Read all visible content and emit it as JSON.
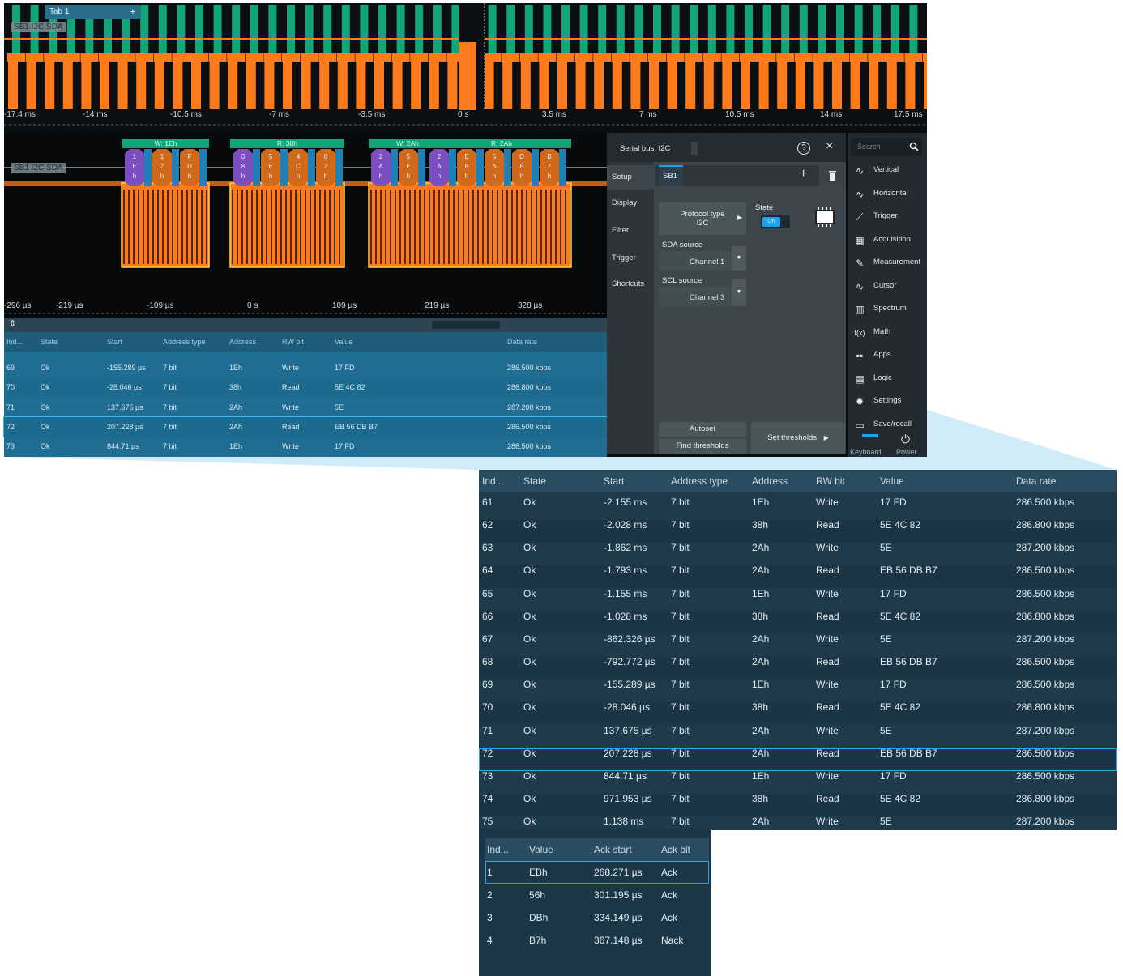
{
  "tab": {
    "label": "Tab 1",
    "plus": "+"
  },
  "overview": {
    "label": "SB1 I2C SDA",
    "ticks": [
      "-17.4 ms",
      "-14 ms",
      "-10.5 ms",
      "-7 ms",
      "-3.5 ms",
      "0 s",
      "3.5 ms",
      "7 ms",
      "10.5 ms",
      "14 ms",
      "17.5 ms"
    ]
  },
  "zoom": {
    "label": "SB1 I2C SDA",
    "frames": [
      "W: 1Eh",
      "R: 38h",
      "W: 2Ah",
      "R: 2Ah"
    ],
    "bytes": [
      [
        "1",
        "E",
        "h"
      ],
      [
        "1",
        "7",
        "h"
      ],
      [
        "F",
        "D",
        "h"
      ],
      [
        "3",
        "8",
        "h"
      ],
      [
        "5",
        "E",
        "h"
      ],
      [
        "4",
        "C",
        "h"
      ],
      [
        "8",
        "2",
        "h"
      ],
      [
        "2",
        "A",
        "h"
      ],
      [
        "5",
        "E",
        "h"
      ],
      [
        "2",
        "A",
        "h"
      ],
      [
        "E",
        "B",
        "h"
      ],
      [
        "5",
        "6",
        "h"
      ],
      [
        "D",
        "B",
        "h"
      ],
      [
        "B",
        "7",
        "h"
      ]
    ],
    "ticks": [
      "-296 µs",
      "-219 µs",
      "-109 µs",
      "0 s",
      "109 µs",
      "219 µs",
      "328 µs"
    ]
  },
  "panel": {
    "title": "Serial bus: I2C",
    "help": "?",
    "close": "×",
    "nav": [
      "Setup",
      "Display",
      "Filter",
      "Trigger",
      "Shortcuts"
    ],
    "sb_tab": "SB1",
    "add": "+",
    "delete_glyph": "🗑",
    "protocol_label": "Protocol type",
    "protocol_value": "I2C",
    "state_label": "State",
    "state_value": "On",
    "sda_label": "SDA source",
    "sda_value": "Channel 1",
    "scl_label": "SCL source",
    "scl_value": "Channel 3",
    "autoset": "Autoset",
    "find_thresholds": "Find thresholds",
    "set_thresholds": "Set thresholds"
  },
  "menu": {
    "search_placeholder": "Search",
    "items": [
      "Vertical",
      "Horizontal",
      "Trigger",
      "Acquisition",
      "Measurement",
      "Cursor",
      "Spectrum",
      "Math",
      "Apps",
      "Logic",
      "Settings",
      "Save/recall"
    ],
    "keyboard": "Keyboard",
    "power": "Power"
  },
  "small_table": {
    "headers": [
      "Ind...",
      "State",
      "Start",
      "Address type",
      "Address",
      "RW bit",
      "Value",
      "Data rate"
    ],
    "rows": [
      [
        "69",
        "Ok",
        "-155.289 µs",
        "7 bit",
        "1Eh",
        "Write",
        "17 FD",
        "286.500 kbps"
      ],
      [
        "70",
        "Ok",
        "-28.046 µs",
        "7 bit",
        "38h",
        "Read",
        "5E 4C 82",
        "286.800 kbps"
      ],
      [
        "71",
        "Ok",
        "137.675 µs",
        "7 bit",
        "2Ah",
        "Write",
        "5E",
        "287.200 kbps"
      ],
      [
        "72",
        "Ok",
        "207.228 µs",
        "7 bit",
        "2Ah",
        "Read",
        "EB 56 DB B7",
        "286.500 kbps"
      ],
      [
        "73",
        "Ok",
        "844.71 µs",
        "7 bit",
        "1Eh",
        "Write",
        "17 FD",
        "286.500 kbps"
      ]
    ],
    "selected_index": 3
  },
  "big_table": {
    "headers": [
      "Ind...",
      "State",
      "Start",
      "Address type",
      "Address",
      "RW bit",
      "Value",
      "Data rate"
    ],
    "rows": [
      [
        "61",
        "Ok",
        "-2.155 ms",
        "7 bit",
        "1Eh",
        "Write",
        "17 FD",
        "286.500 kbps"
      ],
      [
        "62",
        "Ok",
        "-2.028 ms",
        "7 bit",
        "38h",
        "Read",
        "5E 4C 82",
        "286.800 kbps"
      ],
      [
        "63",
        "Ok",
        "-1.862 ms",
        "7 bit",
        "2Ah",
        "Write",
        "5E",
        "287.200 kbps"
      ],
      [
        "64",
        "Ok",
        "-1.793 ms",
        "7 bit",
        "2Ah",
        "Read",
        "EB 56 DB B7",
        "286.500 kbps"
      ],
      [
        "65",
        "Ok",
        "-1.155 ms",
        "7 bit",
        "1Eh",
        "Write",
        "17 FD",
        "286.500 kbps"
      ],
      [
        "66",
        "Ok",
        "-1.028 ms",
        "7 bit",
        "38h",
        "Read",
        "5E 4C 82",
        "286.800 kbps"
      ],
      [
        "67",
        "Ok",
        "-862.326 µs",
        "7 bit",
        "2Ah",
        "Write",
        "5E",
        "287.200 kbps"
      ],
      [
        "68",
        "Ok",
        "-792.772 µs",
        "7 bit",
        "2Ah",
        "Read",
        "EB 56 DB B7",
        "286.500 kbps"
      ],
      [
        "69",
        "Ok",
        "-155.289 µs",
        "7 bit",
        "1Eh",
        "Write",
        "17 FD",
        "286.500 kbps"
      ],
      [
        "70",
        "Ok",
        "-28.046 µs",
        "7 bit",
        "38h",
        "Read",
        "5E 4C 82",
        "286.800 kbps"
      ],
      [
        "71",
        "Ok",
        "137.675 µs",
        "7 bit",
        "2Ah",
        "Write",
        "5E",
        "287.200 kbps"
      ],
      [
        "72",
        "Ok",
        "207.228 µs",
        "7 bit",
        "2Ah",
        "Read",
        "EB 56 DB B7",
        "286.500 kbps"
      ],
      [
        "73",
        "Ok",
        "844.71 µs",
        "7 bit",
        "1Eh",
        "Write",
        "17 FD",
        "286.500 kbps"
      ],
      [
        "74",
        "Ok",
        "971.953 µs",
        "7 bit",
        "38h",
        "Read",
        "5E 4C 82",
        "286.800 kbps"
      ],
      [
        "75",
        "Ok",
        "1.138 ms",
        "7 bit",
        "2Ah",
        "Write",
        "5E",
        "287.200 kbps"
      ]
    ],
    "selected_index": 11
  },
  "detail_table": {
    "headers": [
      "Ind...",
      "Value",
      "Ack start",
      "Ack bit"
    ],
    "rows": [
      [
        "1",
        "EBh",
        "268.271 µs",
        "Ack"
      ],
      [
        "2",
        "56h",
        "301.195 µs",
        "Ack"
      ],
      [
        "3",
        "DBh",
        "334.149 µs",
        "Ack"
      ],
      [
        "4",
        "B7h",
        "367.148 µs",
        "Nack"
      ]
    ],
    "selected_index": 0
  },
  "colors": {
    "accent": "#1aa3e8",
    "signal": "#ff7a1a",
    "bus": "#12a57a",
    "panel": "#3d464d",
    "table": "#1e3a4b"
  }
}
